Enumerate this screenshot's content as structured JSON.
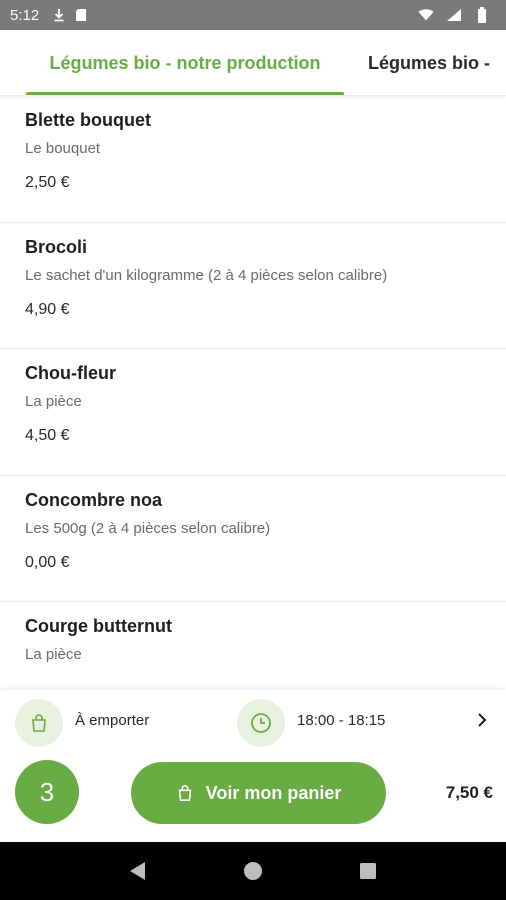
{
  "status_bar": {
    "time": "5:12"
  },
  "tabs": [
    {
      "label": "Légumes bio - notre production"
    },
    {
      "label": "Légumes bio -"
    }
  ],
  "products": [
    {
      "name": "Blette bouquet",
      "description": "Le bouquet",
      "price": "2,50 €"
    },
    {
      "name": "Brocoli",
      "description": "Le sachet d'un kilogramme (2 à 4 pièces selon calibre)",
      "price": "4,90 €"
    },
    {
      "name": "Chou-fleur",
      "description": "La pièce",
      "price": "4,50 €"
    },
    {
      "name": "Concombre noa",
      "description": "Les 500g (2 à 4 pièces selon calibre)",
      "price": "0,00 €"
    },
    {
      "name": "Courge butternut",
      "description": "La pièce",
      "price": ""
    }
  ],
  "order": {
    "mode_label": "À emporter",
    "time_slot": "18:00 - 18:15",
    "item_count": "3",
    "cart_button_label": "Voir mon panier",
    "total": "7,50 €"
  },
  "icons": {
    "mode": "shopping-bag-icon",
    "time": "clock-icon",
    "chevron": "chevron-right-icon",
    "cart": "shopping-bag-icon"
  },
  "colors": {
    "accent": "#6aac44",
    "accent_light": "#e8f1df",
    "status_bar": "#7a7a7a"
  }
}
